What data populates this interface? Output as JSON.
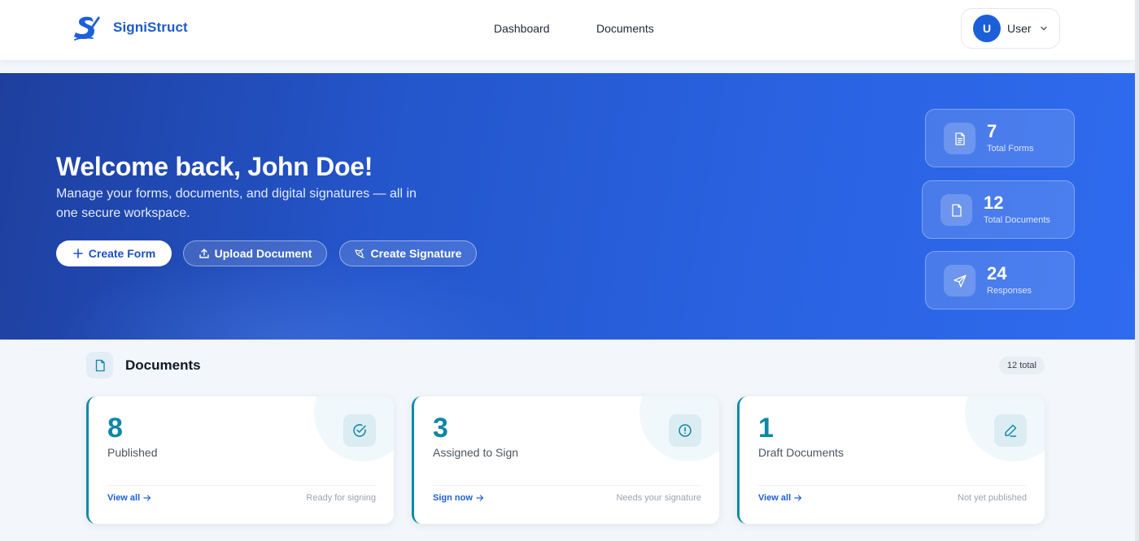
{
  "brand": {
    "name": "SigniStruct"
  },
  "nav": {
    "dashboard": "Dashboard",
    "documents": "Documents"
  },
  "user": {
    "initial": "U",
    "label": "User"
  },
  "hero": {
    "title": "Welcome back, John Doe!",
    "subtitle": "Manage your forms, documents, and digital signatures — all in one secure workspace.",
    "buttons": {
      "create_form": "Create Form",
      "upload_document": "Upload Document",
      "create_signature": "Create Signature"
    },
    "stats": [
      {
        "value": "7",
        "label": "Total Forms",
        "icon": "file-text-icon"
      },
      {
        "value": "12",
        "label": "Total Documents",
        "icon": "file-icon"
      },
      {
        "value": "24",
        "label": "Responses",
        "icon": "send-icon"
      }
    ]
  },
  "documents": {
    "title": "Documents",
    "total_badge": "12 total",
    "cards": [
      {
        "count": "8",
        "label": "Published",
        "action": "View all",
        "hint": "Ready for signing",
        "icon": "check-circle-icon"
      },
      {
        "count": "3",
        "label": "Assigned to Sign",
        "action": "Sign now",
        "hint": "Needs your signature",
        "icon": "alert-circle-icon"
      },
      {
        "count": "1",
        "label": "Draft Documents",
        "action": "View all",
        "hint": "Not yet published",
        "icon": "pen-icon"
      }
    ]
  },
  "colors": {
    "brand": "#1f5bc8",
    "hero_start": "#1e3f9e",
    "hero_end": "#2f6bef",
    "teal_accent": "#0e87a5",
    "link": "#1d5fd8"
  }
}
